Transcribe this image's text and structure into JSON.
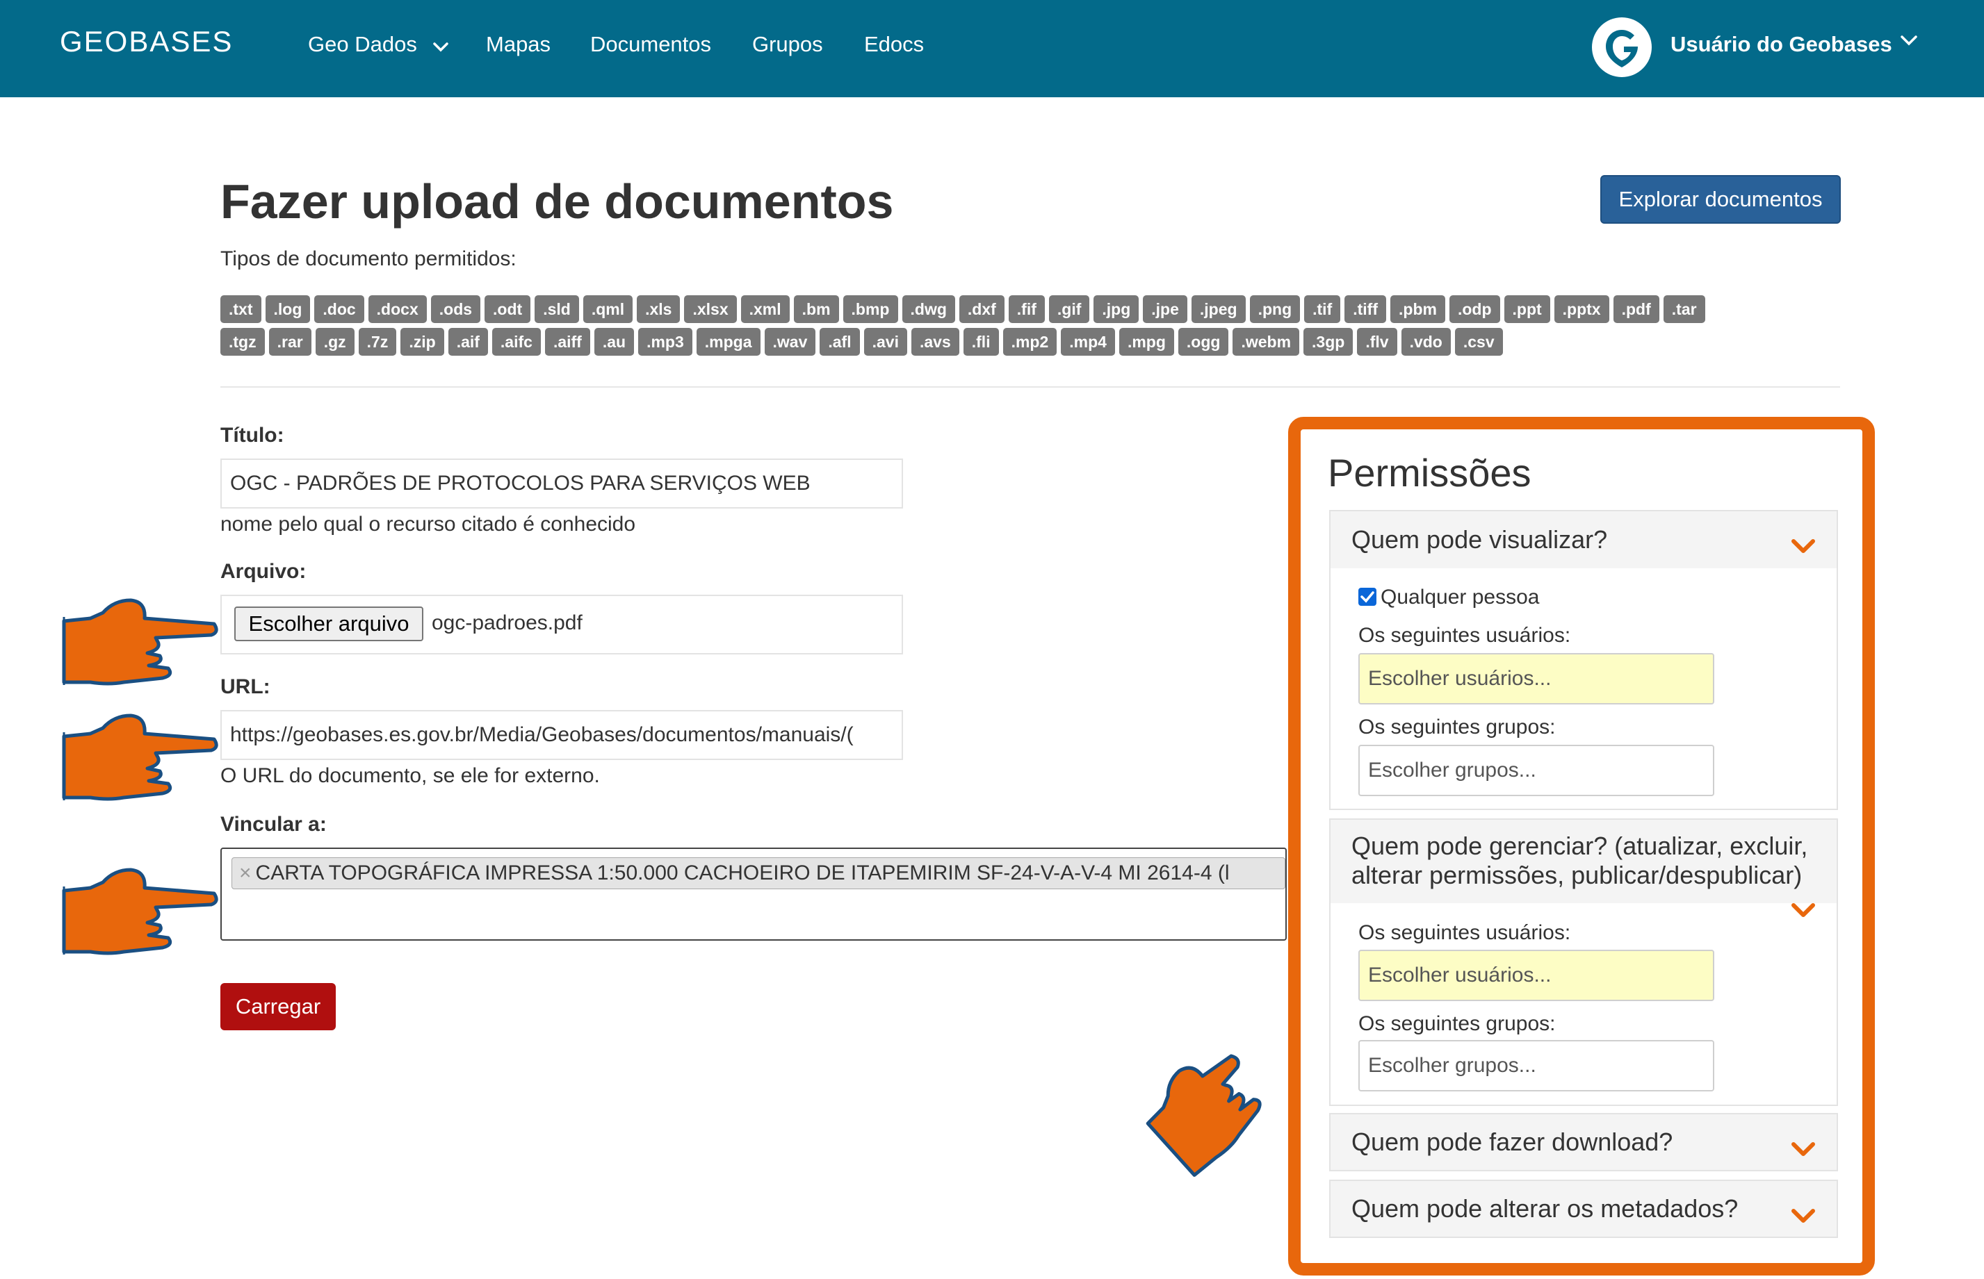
{
  "navbar": {
    "brand": "GEOBASES",
    "items": [
      "Geo Dados",
      "Mapas",
      "Documentos",
      "Grupos",
      "Edocs"
    ],
    "user_name": "Usuário do Geobases",
    "bg_color": "#036a8a"
  },
  "header": {
    "title": "Fazer upload de documentos",
    "explore_button": "Explorar documentos",
    "types_label": "Tipos de documento permitidos:",
    "types": [
      ".txt",
      ".log",
      ".doc",
      ".docx",
      ".ods",
      ".odt",
      ".sld",
      ".qml",
      ".xls",
      ".xlsx",
      ".xml",
      ".bm",
      ".bmp",
      ".dwg",
      ".dxf",
      ".fif",
      ".gif",
      ".jpg",
      ".jpe",
      ".jpeg",
      ".png",
      ".tif",
      ".tiff",
      ".pbm",
      ".odp",
      ".ppt",
      ".pptx",
      ".pdf",
      ".tar",
      ".tgz",
      ".rar",
      ".gz",
      ".7z",
      ".zip",
      ".aif",
      ".aifc",
      ".aiff",
      ".au",
      ".mp3",
      ".mpga",
      ".wav",
      ".afl",
      ".avi",
      ".avs",
      ".fli",
      ".mp2",
      ".mp4",
      ".mpg",
      ".ogg",
      ".webm",
      ".3gp",
      ".flv",
      ".vdo",
      ".csv"
    ]
  },
  "form": {
    "title_label": "Título:",
    "title_value": "OGC - PADRÕES DE PROTOCOLOS PARA SERVIÇOS WEB",
    "title_help": "nome pelo qual o recurso citado é conhecido",
    "file_label": "Arquivo:",
    "file_button": "Escolher arquivo",
    "file_name": "ogc-padroes.pdf",
    "url_label": "URL:",
    "url_value": "https://geobases.es.gov.br/Media/Geobases/documentos/manuais/(",
    "url_help": "O URL do documento, se ele for externo.",
    "link_label": "Vincular a:",
    "link_chip": "CARTA TOPOGRÁFICA IMPRESSA 1:50.000 CACHOEIRO DE ITAPEMIRIM SF-24-V-A-V-4 MI 2614-4 (l",
    "chip_remove": "×",
    "submit": "Carregar"
  },
  "permissions": {
    "title": "Permissões",
    "view": {
      "heading": "Quem pode visualizar?",
      "anyone_label": "Qualquer pessoa",
      "anyone_checked": true,
      "users_label": "Os seguintes usuários:",
      "users_placeholder": "Escolher usuários...",
      "groups_label": "Os seguintes grupos:",
      "groups_placeholder": "Escolher grupos..."
    },
    "manage": {
      "heading_line1": "Quem pode gerenciar? (atualizar, excluir,",
      "heading_line2": "alterar permissões, publicar/despublicar)",
      "users_label": "Os seguintes usuários:",
      "users_placeholder": "Escolher usuários...",
      "groups_label": "Os seguintes grupos:",
      "groups_placeholder": "Escolher grupos..."
    },
    "download": {
      "heading": "Quem pode fazer download?"
    },
    "metadata": {
      "heading": "Quem pode alterar os metadados?"
    },
    "highlight_color": "#e8670c"
  }
}
